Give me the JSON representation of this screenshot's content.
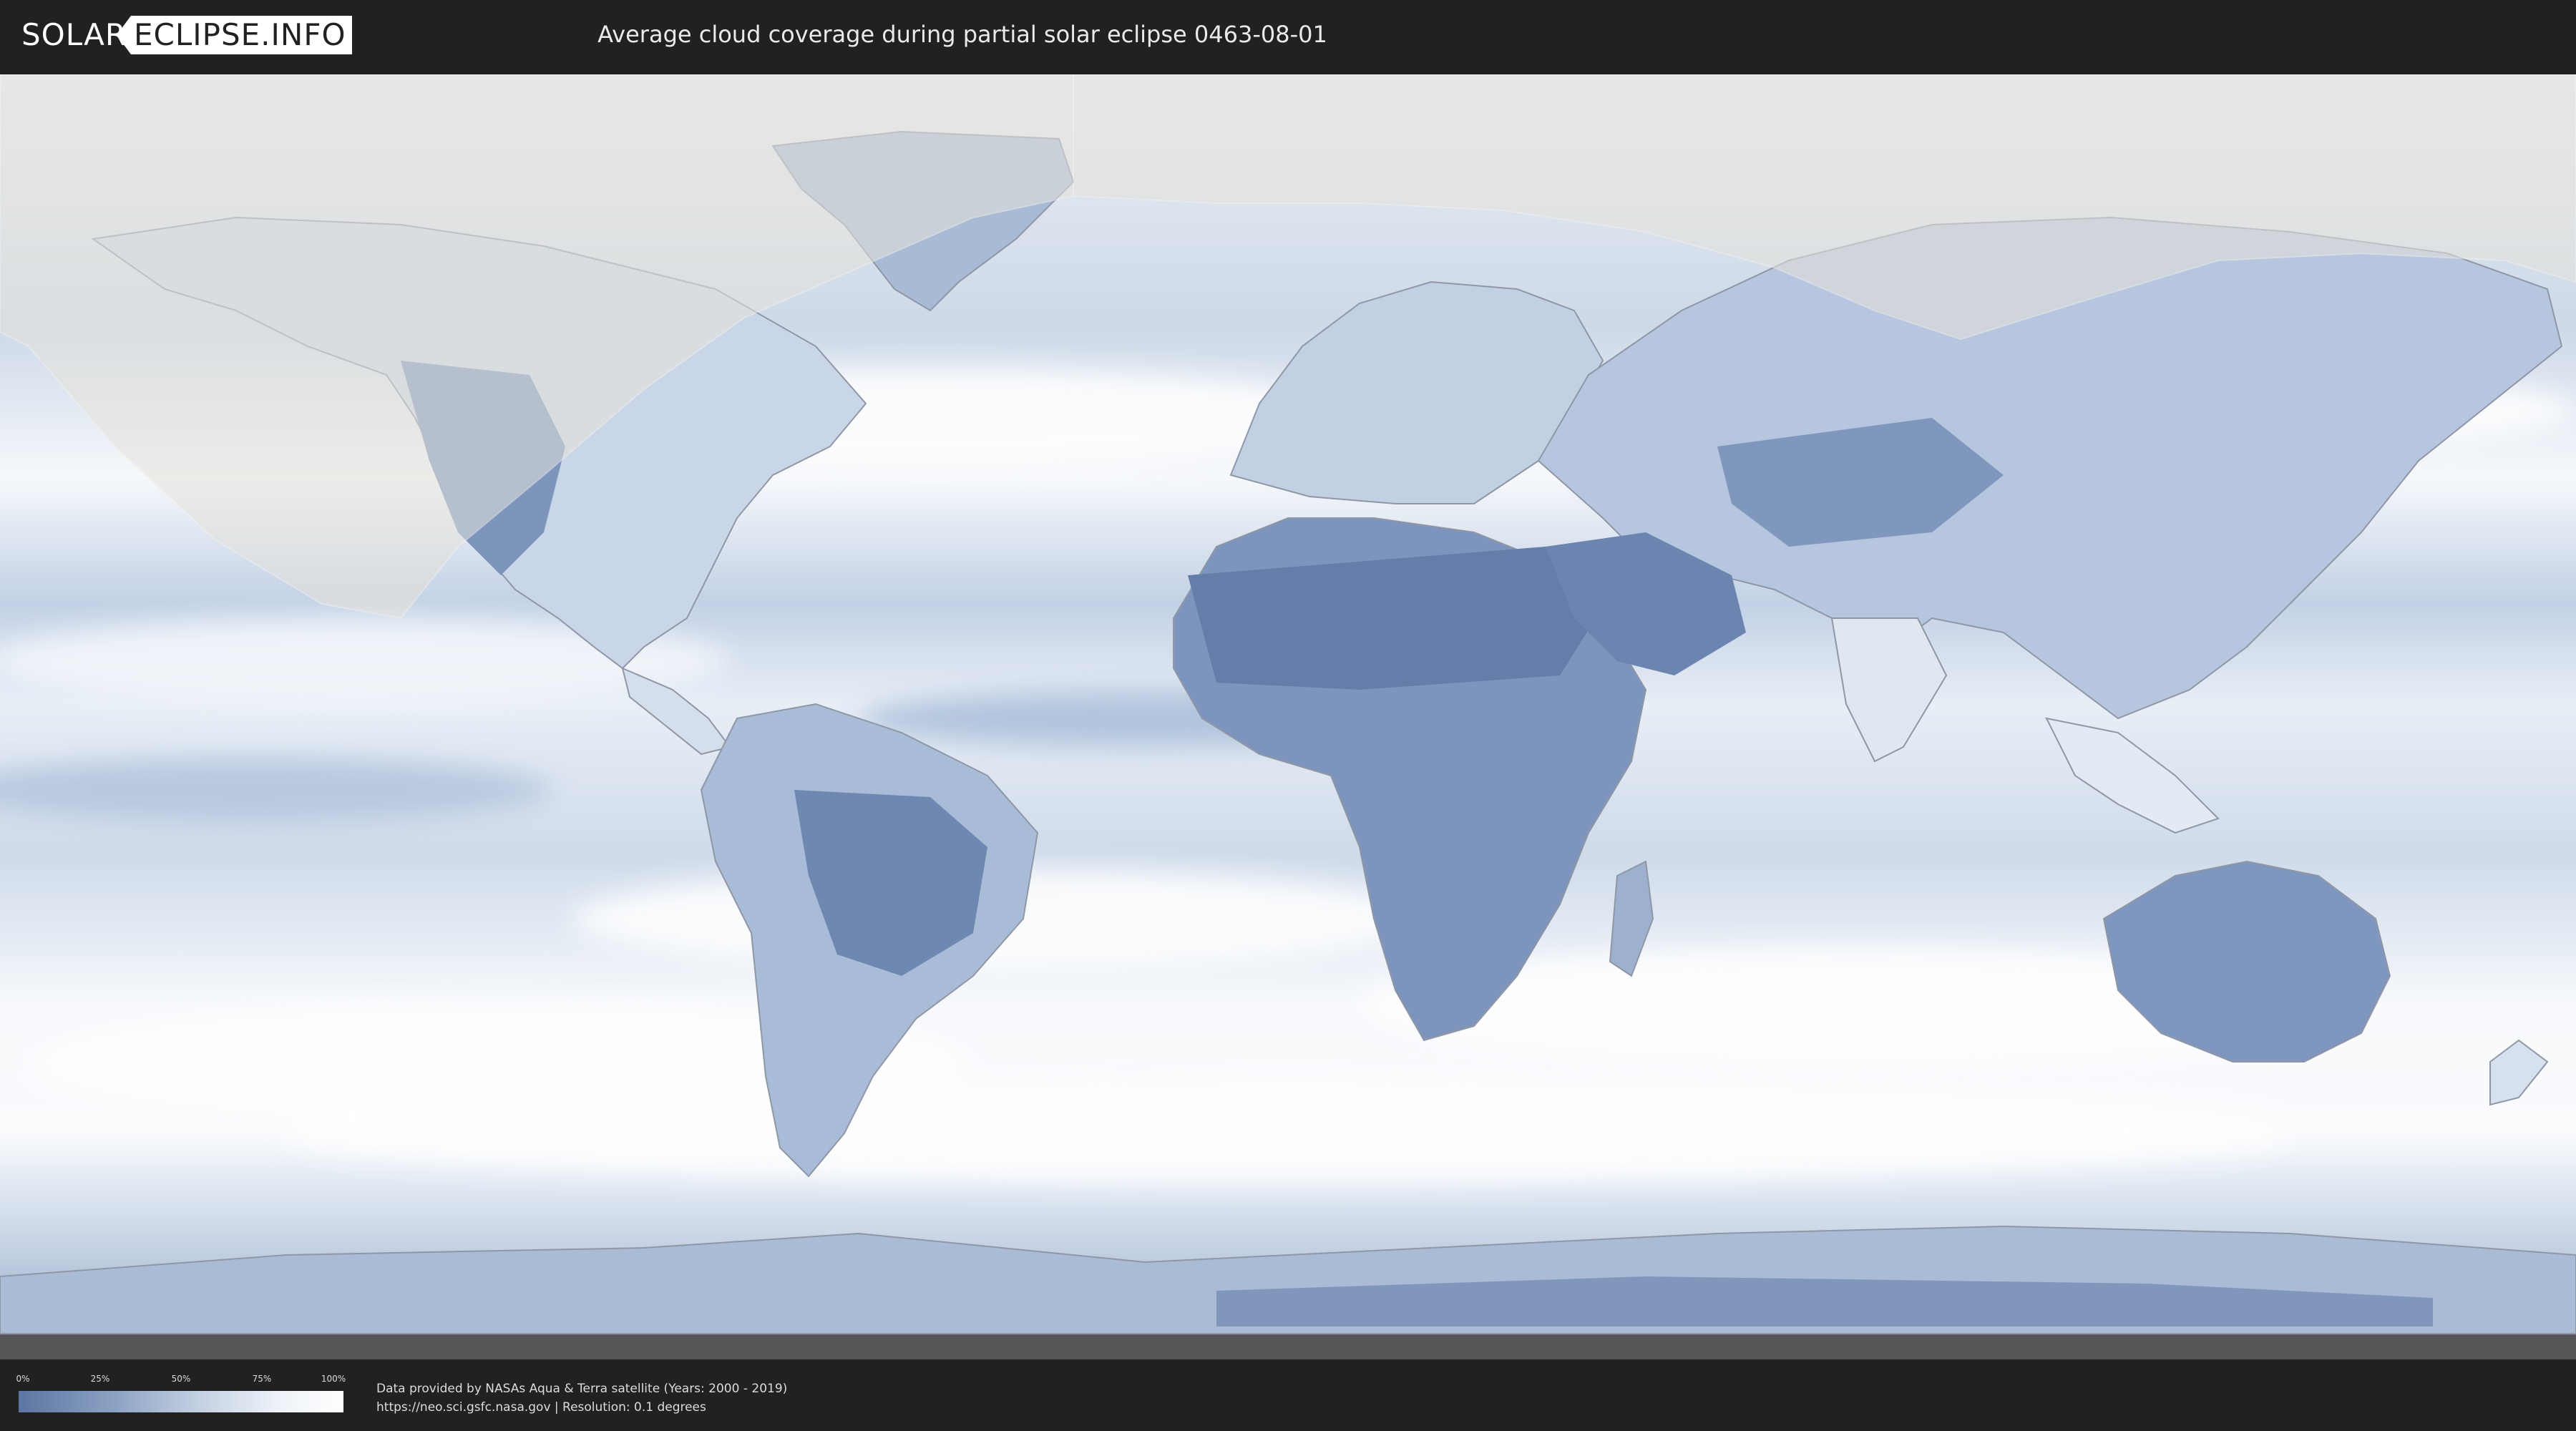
{
  "header": {
    "logo_part1": "SOLAR",
    "logo_part2": "ECLIPSE.INFO",
    "title": "Average cloud coverage during partial solar eclipse 0463-08-01"
  },
  "legend": {
    "ticks": [
      "0%",
      "25%",
      "50%",
      "75%",
      "100%"
    ],
    "gradient_colors": [
      "#5c76a2",
      "#ffffff"
    ]
  },
  "footer": {
    "credit_line1": "Data provided by NASAs Aqua & Terra satellite (Years: 2000 - 2019)",
    "credit_line2": "https://neo.sci.gsfc.nasa.gov | Resolution: 0.1 degrees"
  },
  "map": {
    "colors": {
      "ocean_clear": "#b9c9df",
      "land_clear": "#6c86b0",
      "cloudy": "#f4f7fb",
      "eclipse_overlay": "#e6e3dc"
    }
  }
}
